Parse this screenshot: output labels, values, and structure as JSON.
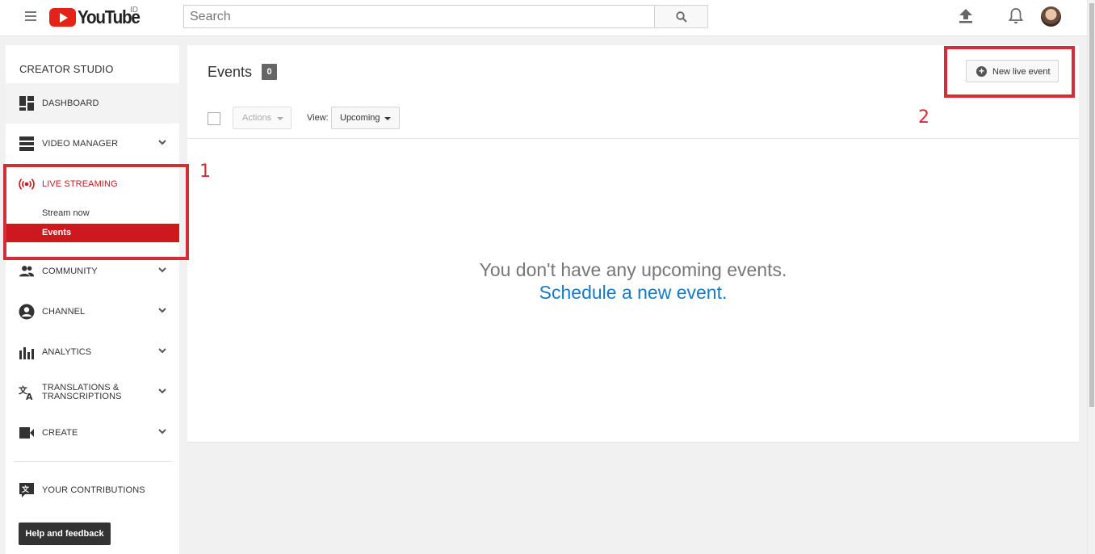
{
  "header": {
    "logo_text": "YouTube",
    "country_code": "ID",
    "search_placeholder": "Search",
    "icons": [
      "menu-icon",
      "search-icon",
      "upload-icon",
      "bell-icon",
      "avatar"
    ]
  },
  "sidebar": {
    "title": "CREATOR STUDIO",
    "items": [
      {
        "label": "DASHBOARD",
        "icon": "dashboard-icon"
      },
      {
        "label": "VIDEO MANAGER",
        "icon": "video-manager-icon"
      },
      {
        "label": "LIVE STREAMING",
        "icon": "live-streaming-icon"
      },
      {
        "label": "COMMUNITY",
        "icon": "community-icon"
      },
      {
        "label": "CHANNEL",
        "icon": "channel-icon"
      },
      {
        "label": "ANALYTICS",
        "icon": "analytics-icon"
      },
      {
        "label_line1": "TRANSLATIONS &",
        "label_line2": "TRANSCRIPTIONS",
        "icon": "translations-icon"
      },
      {
        "label": "CREATE",
        "icon": "create-icon"
      },
      {
        "label": "YOUR CONTRIBUTIONS",
        "icon": "contributions-icon"
      }
    ],
    "live_sub_items": [
      {
        "label": "Stream now"
      },
      {
        "label": "Events"
      }
    ],
    "help_button": "Help and feedback"
  },
  "main": {
    "title": "Events",
    "count": "0",
    "new_event_button": "New live event",
    "actions_label": "Actions",
    "view_label": "View:",
    "view_value": "Upcoming",
    "empty_message": "You don't have any upcoming events.",
    "schedule_link": "Schedule a new event."
  },
  "annotations": {
    "one": "1",
    "two": "2"
  },
  "colors": {
    "accent_red": "#cc181e",
    "annotation_red": "#d52d35",
    "link_blue": "#167ac6"
  }
}
